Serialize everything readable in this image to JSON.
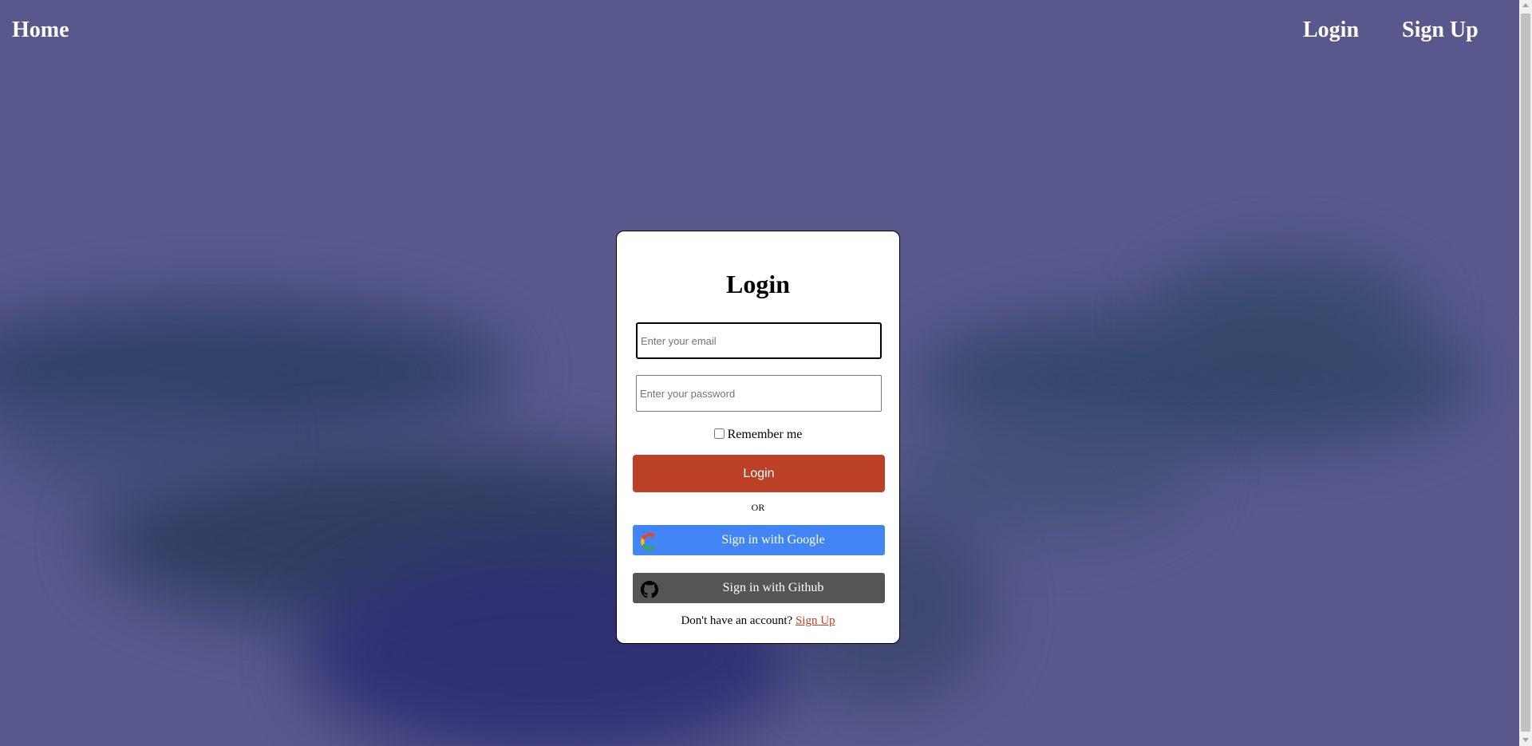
{
  "navbar": {
    "home": "Home",
    "login": "Login",
    "signup": "Sign Up"
  },
  "login_card": {
    "title": "Login",
    "email_placeholder": "Enter your email",
    "password_placeholder": "Enter your password",
    "remember_label": "Remember me",
    "remember_checked": false,
    "login_button": "Login",
    "or_text": "OR",
    "google_button": "Sign in with Google",
    "github_button": "Sign in with Github",
    "signup_prompt": "Don't have an account?",
    "signup_link": "Sign Up"
  },
  "colors": {
    "background": "#58588c",
    "login_button": "#bb4026",
    "google_button": "#4285f4",
    "github_button": "#555555",
    "link": "#bb4026"
  },
  "icons": {
    "google": "google-g-logo-icon",
    "github": "github-octocat-icon"
  }
}
